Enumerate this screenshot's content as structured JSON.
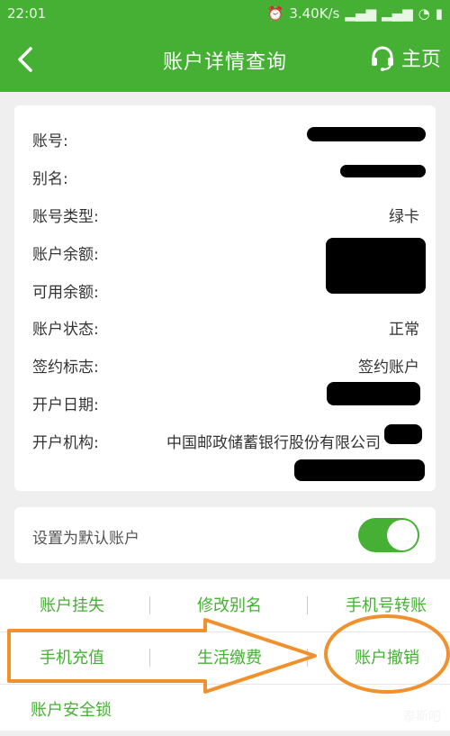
{
  "status": {
    "time": "22:01",
    "speed": "3.40K/s"
  },
  "appbar": {
    "title": "账户详情查询",
    "home_label": "主页"
  },
  "details": [
    {
      "label": "账号:",
      "value": ""
    },
    {
      "label": "别名:",
      "value": ""
    },
    {
      "label": "账号类型:",
      "value": "绿卡"
    },
    {
      "label": "账户余额:",
      "value": ""
    },
    {
      "label": "可用余额:",
      "value": ""
    },
    {
      "label": "账户状态:",
      "value": "正常"
    },
    {
      "label": "签约标志:",
      "value": "签约账户"
    },
    {
      "label": "开户日期:",
      "value": ""
    },
    {
      "label": "开户机构:",
      "value": "中国邮政储蓄银行股份有限公司"
    }
  ],
  "default_toggle": {
    "label": "设置为默认账户",
    "on": true
  },
  "actions": {
    "report_loss": "账户挂失",
    "edit_alias": "修改别名",
    "phone_transfer": "手机号转账",
    "phone_topup": "手机充值",
    "bill_pay": "生活缴费",
    "cancel_account": "账户撤销",
    "security_lock": "账户安全锁"
  },
  "colors": {
    "brand_green": "#46b035",
    "annotation_orange": "#f0912e"
  },
  "watermark": "泰斯吧"
}
